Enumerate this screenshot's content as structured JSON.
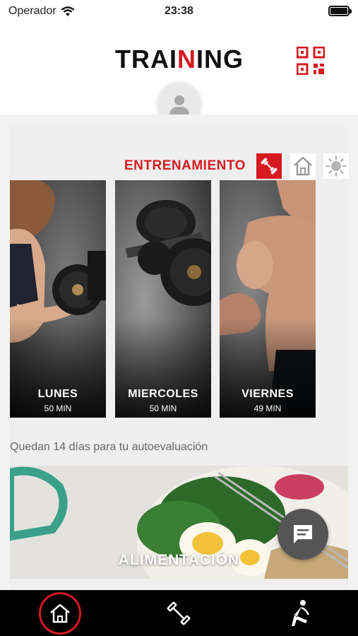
{
  "status_bar": {
    "carrier": "Operador",
    "time": "23:38"
  },
  "header": {
    "logo_text": "TRAINING",
    "logo_left": "TRAI",
    "logo_mark": "N",
    "logo_right": "ING"
  },
  "section": {
    "title": "ENTRENAMIENTO"
  },
  "mode_icons": [
    "dumbbell-icon",
    "home-icon",
    "outdoor-icon"
  ],
  "workouts": [
    {
      "day": "LUNES",
      "duration": "50 MIN"
    },
    {
      "day": "MIERCOLES",
      "duration": "50 MIN"
    },
    {
      "day": "VIERNES",
      "duration": "49 MIN"
    }
  ],
  "evaluation_notice": "Quedan 14 días para tu autoevaluación",
  "food_card": {
    "label": "ALIMENTACIÓN"
  },
  "colors": {
    "accent": "#d71920",
    "nav_bg": "#000000",
    "fab": "#555555"
  }
}
